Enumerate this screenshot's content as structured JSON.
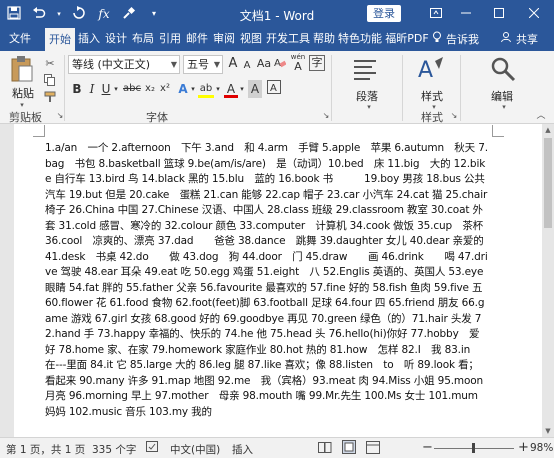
{
  "titlebar": {
    "title": "文档1 - Word",
    "login": "登录",
    "icons": [
      "save-icon",
      "undo-icon",
      "redo-icon",
      "formula-icon",
      "brush-icon",
      "customize-icon"
    ]
  },
  "tabs": {
    "items": [
      "文件",
      "开始",
      "插入",
      "设计",
      "布局",
      "引用",
      "邮件",
      "审阅",
      "视图",
      "开发工具",
      "帮助",
      "特色功能",
      "福昕PDF"
    ],
    "active": "开始",
    "tell_me": "告诉我",
    "share": "共享"
  },
  "ribbon": {
    "paste_label": "粘贴",
    "font_name": "等线 (中文正文)",
    "font_size": "五号",
    "font_size_up": "A",
    "font_size_down": "A",
    "clear_format": "Aa",
    "wen": "wén",
    "wen_char": "A",
    "bold": "B",
    "italic": "I",
    "underline": "U",
    "strike": "abc",
    "sub": "x₂",
    "sup": "x²",
    "effects": "A",
    "highlight": "ab",
    "font_color": "A",
    "char_shade": "A",
    "encircle": "字",
    "paragraph_label": "段落",
    "styles_label": "样式",
    "editing_label": "编辑",
    "groups": {
      "clipboard": "剪贴板",
      "font": "字体"
    }
  },
  "document": {
    "text": "1.a/an　一个 2.afternoon　下午 3.and　和 4.arm　手臂 5.apple　苹果 6.autumn　秋天 7.bag　书包 8.basketball 篮球 9.be(am/is/are)　是（动词）10.bed　床 11.big　大的 12.bike 自行车 13.bird 鸟 14.black 黑的 15.blu　蓝的 16.book 书　　　19.boy 男孩 18.bus 公共汽车 19.but 但是 20.cake　蛋糕 21.can 能够 22.cap 帽子 23.car 小汽车 24.cat 猫 25.chair 椅子 26.China 中国 27.Chinese 汉语、中国人 28.class 班级 29.classroom 教室 30.coat 外套 31.cold 感冒、寒冷的 32.colour 颜色 33.computer　计算机 34.cook 做饭 35.cup　茶杯 36.cool　凉爽的、漂亮 37.dad　　爸爸 38.dance　跳舞 39.daughter 女儿 40.dear 亲爱的 41.desk　书桌 42.do　　做 43.dog　狗 44.door　门 45.draw　　画 46.drink　　喝 47.drive 驾驶 48.ear 耳朵 49.eat 吃 50.egg 鸡蛋 51.eight　八 52.Englis 英语的、英国人 53.eye　眼睛 54.fat 胖的 55.father 父亲 56.favourite 最喜欢的 57.fine 好的 58.fish 鱼肉 59.five 五 60.flower 花 61.food 食物 62.foot(feet)脚 63.football 足球 64.four 四 65.friend 朋友 66.game 游戏 67.girl 女孩 68.good 好的 69.goodbye 再见 70.green 绿色（的）71.hair 头发 72.hand 手 73.happy 幸福的、快乐的 74.he 他 75.head 头 76.hello(hi)你好 77.hobby　爱好 78.home 家、在家 79.homework 家庭作业 80.hot 热的 81.how　怎样 82.I　我 83.in　在---里面 84.it 它 85.large 大的 86.leg 腿 87.like 喜欢；像 88.listen　to　听 89.look 看；看起来 90.many 许多 91.map 地图 92.me　我（宾格）93.meat 肉 94.Miss 小姐 95.moon 月亮 96.morning 早上 97.mother　母亲 98.mouth 嘴 99.Mr.先生 100.Ms 女士 101.mum 妈妈 102.music 音乐 103.my 我的"
  },
  "status": {
    "page": "第 1 页，共 1 页",
    "words": "335 个字",
    "proofing_icon": "proofing-icon",
    "language": "中文(中国)",
    "insert_mode": "插入",
    "zoom": "98%",
    "zoom_minus": "−",
    "zoom_plus": "+"
  },
  "colors": {
    "accent": "#2b579a",
    "ribbon": "#f3f3f3",
    "canvas": "#e6e6e6"
  }
}
